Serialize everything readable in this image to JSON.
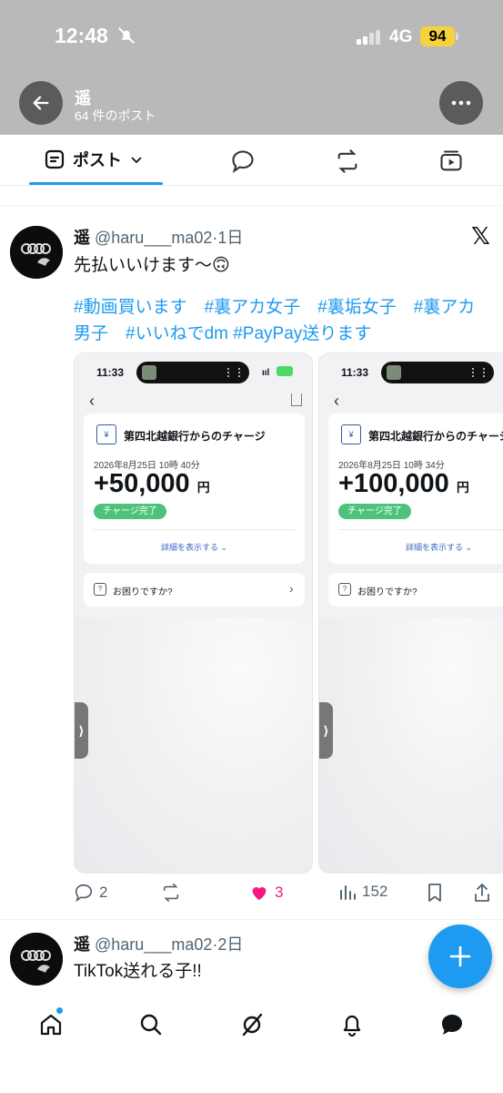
{
  "status_bar": {
    "time": "12:48",
    "network": "4G",
    "battery": "94"
  },
  "header": {
    "name": "遥",
    "post_count": "64 件のポスト"
  },
  "tabs": {
    "posts_label": "ポスト"
  },
  "tweets": [
    {
      "name": "遥",
      "handle": "@haru___ma02",
      "age": "1日",
      "text": "先払いいけます〜🙃",
      "hashtags": "#動画買います　#裏アカ女子　#裏垢女子　#裏アカ男子　#いいねでdm #PayPay送ります",
      "media": [
        {
          "time": "11:33",
          "bank": "第四北越銀行からのチャージ",
          "date": "2026年8月25日 10時 40分",
          "amount": "+50,000",
          "currency": "円",
          "badge": "チャージ完了",
          "detail": "詳細を表示する ⌄",
          "help": "お困りですか?"
        },
        {
          "time": "11:33",
          "bank": "第四北越銀行からのチャージ",
          "date": "2026年8月25日 10時 34分",
          "amount": "+100,000",
          "currency": "円",
          "badge": "チャージ完了",
          "detail": "詳細を表示する ⌄",
          "help": "お困りですか?"
        }
      ],
      "replies": "2",
      "likes": "3",
      "views": "152"
    },
    {
      "name": "遥",
      "handle": "@haru___ma02",
      "age": "2日",
      "text": "TikTok送れる子!!"
    }
  ],
  "colors": {
    "accent": "#1d9bf0",
    "like": "#f91880",
    "header_overlay": "#b9b9b9"
  }
}
